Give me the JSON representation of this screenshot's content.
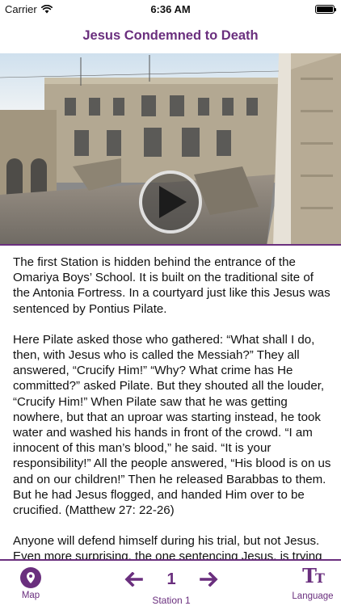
{
  "status_bar": {
    "carrier": "Carrier",
    "time": "6:36 AM",
    "battery_level": 1.0
  },
  "header": {
    "title": "Jesus Condemned to Death"
  },
  "video": {
    "play_icon": "play-icon"
  },
  "content": {
    "paragraphs": [
      "The first Station is hidden behind the entrance of the Omariya Boys’ School. It is built on the traditional site of the Antonia Fortress. In a courtyard just like this Jesus was sentenced by Pontius Pilate.",
      "Here Pilate asked those who gathered: “What shall I do, then, with Jesus who is called the Messiah?” They all answered, “Crucify Him!” “Why? What crime has He committed?” asked Pilate. But they shouted all the louder, “Crucify Him!” When Pilate saw that he was getting nowhere, but that an uproar was starting instead, he took water and washed his hands in front of the crowd. “I am innocent of this man’s blood,” he said. “It is your responsibility!” All the people answered, “His blood is on us and on our children!” Then he released Barabbas to them. But he had Jesus flogged, and handed Him over to be crucified. (Matthew 27: 22-26)",
      "Anyone will defend himself during his trial, but not Jesus. Even more surprising, the one sentencing Jesus, is trying to rescue Him."
    ]
  },
  "tab_bar": {
    "map_label": "Map",
    "station_number": "1",
    "station_label": "Station 1",
    "language_label": "Language",
    "accent_color": "#6a2f7e"
  }
}
